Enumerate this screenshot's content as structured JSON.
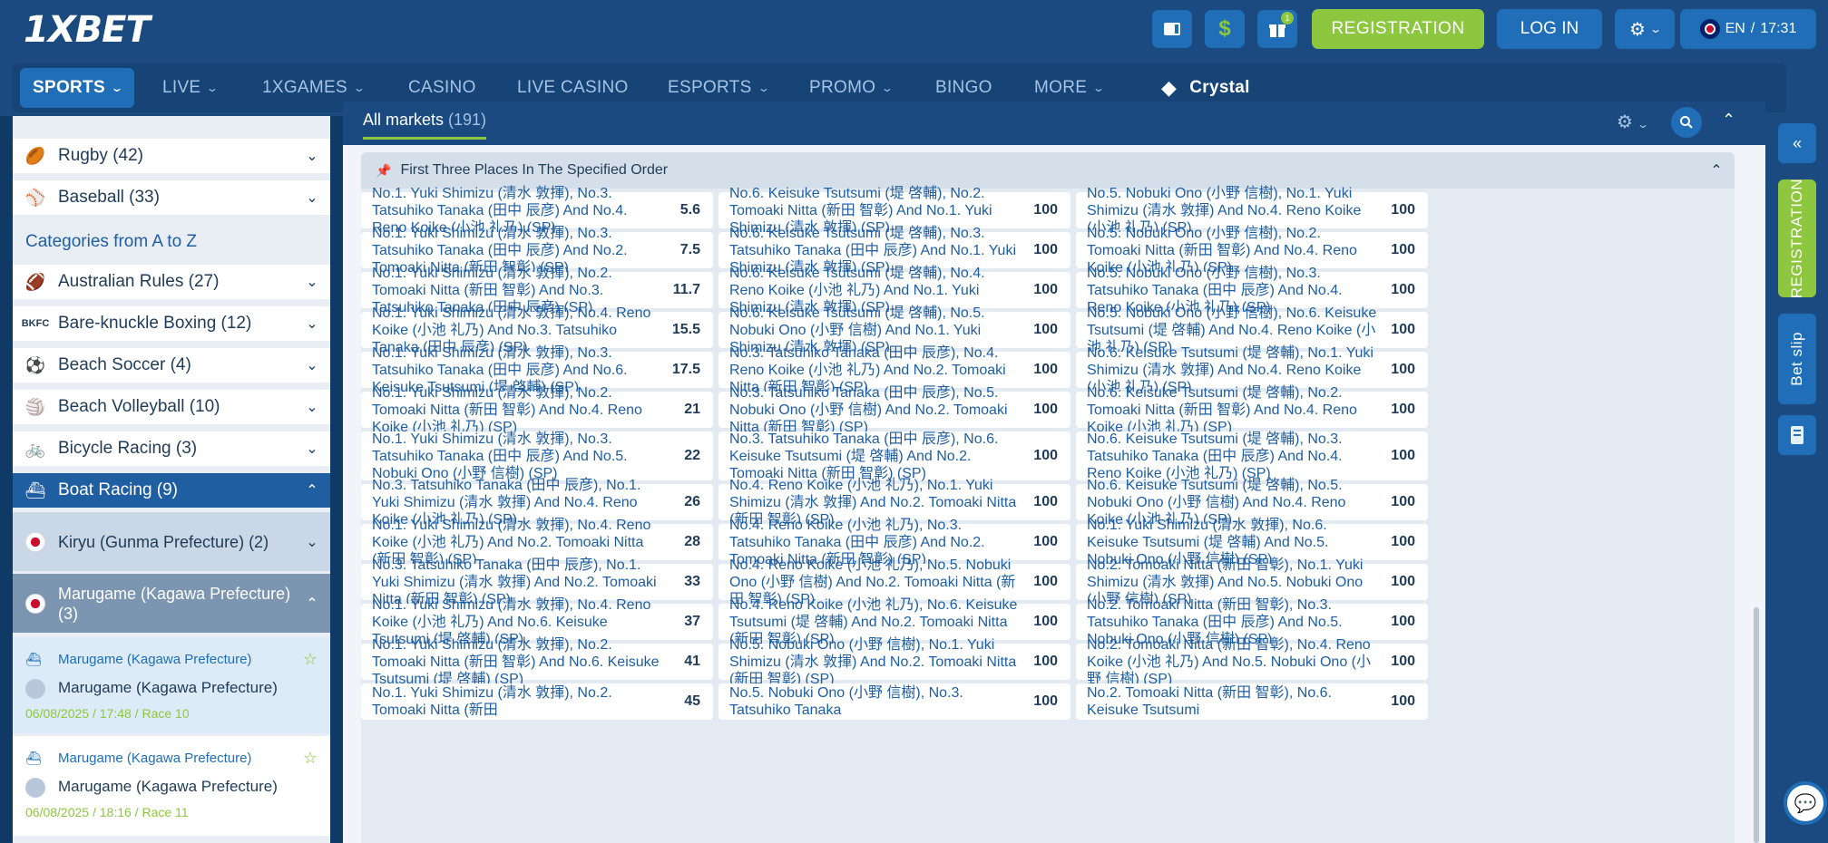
{
  "brand": {
    "logo": "1XBET"
  },
  "topbar": {
    "gift_badge": "1",
    "registration": "REGISTRATION",
    "login": "LOG IN",
    "lang": "EN",
    "separator": "/",
    "time": "17:31"
  },
  "nav": {
    "items": [
      {
        "label": "SPORTS",
        "chevron": true
      },
      {
        "label": "LIVE",
        "chevron": true
      },
      {
        "label": "1XGAMES",
        "chevron": true
      },
      {
        "label": "CASINO",
        "chevron": false
      },
      {
        "label": "LIVE CASINO",
        "chevron": false
      },
      {
        "label": "ESPORTS",
        "chevron": true
      },
      {
        "label": "PROMO",
        "chevron": true
      },
      {
        "label": "BINGO",
        "chevron": false
      },
      {
        "label": "MORE",
        "chevron": true
      },
      {
        "label": "Crystal",
        "chevron": false
      }
    ]
  },
  "sidebar": {
    "top_sports": [
      {
        "label": "Rugby (42)",
        "icon": "rugby-ball-icon"
      },
      {
        "label": "Baseball (33)",
        "icon": "baseball-icon"
      }
    ],
    "categories_heading": "Categories from A to Z",
    "categories": [
      {
        "label": "Australian Rules (27)",
        "icon": "aussie-rules-ball-icon"
      },
      {
        "label": "Bare-knuckle Boxing (12)",
        "icon": "boxing-icon"
      },
      {
        "label": "Beach Soccer (4)",
        "icon": "soccer-ball-icon"
      },
      {
        "label": "Beach Volleyball (10)",
        "icon": "volleyball-icon"
      },
      {
        "label": "Bicycle Racing (3)",
        "icon": "bicycle-icon"
      }
    ],
    "boat": {
      "label": "Boat Racing (9)",
      "icon": "boat-icon"
    },
    "leagues": [
      {
        "label": "Kiryu (Gunma Prefecture) (2)"
      },
      {
        "label": "Marugame (Kagawa Prefecture) (3)"
      }
    ],
    "events": [
      {
        "league": "Marugame (Kagawa Prefecture)",
        "name": "Marugame (Kagawa Prefecture)",
        "date": "06/08/2025",
        "sep": " / ",
        "time": "17:48",
        "race": "Race 10"
      },
      {
        "league": "Marugame (Kagawa Prefecture)",
        "name": "Marugame (Kagawa Prefecture)",
        "date": "06/08/2025",
        "sep": " / ",
        "time": "18:16",
        "race": "Race 11"
      }
    ]
  },
  "markets": {
    "tab_label": "All markets",
    "tab_count": "(191)",
    "group_title": "First Three Places In The Specified Order",
    "rows": [
      [
        {
          "t": "No.1. Yuki Shimizu (清水 敦揮), No.3. Tatsuhiko Tanaka (田中 辰彦) And No.4. Reno Koike (小池 礼乃) (SP)",
          "o": "5.6"
        },
        {
          "t": "No.6. Keisuke Tsutsumi (堤 啓輔), No.2. Tomoaki Nitta (新田 智彰) And No.1. Yuki Shimizu (清水 敦揮) (SP)",
          "o": "100"
        },
        {
          "t": "No.5. Nobuki Ono (小野 信樹), No.1. Yuki Shimizu (清水 敦揮) And No.4. Reno Koike (小池 礼乃) (SP)",
          "o": "100"
        }
      ],
      [
        {
          "t": "No.1. Yuki Shimizu (清水 敦揮), No.3. Tatsuhiko Tanaka (田中 辰彦) And No.2. Tomoaki Nitta (新田 智彰) (SP)",
          "o": "7.5"
        },
        {
          "t": "No.6. Keisuke Tsutsumi (堤 啓輔), No.3. Tatsuhiko Tanaka (田中 辰彦) And No.1. Yuki Shimizu (清水 敦揮) (SP)",
          "o": "100"
        },
        {
          "t": "No.5. Nobuki Ono (小野 信樹), No.2. Tomoaki Nitta (新田 智彰) And No.4. Reno Koike (小池 礼乃) (SP)",
          "o": "100"
        }
      ],
      [
        {
          "t": "No.1. Yuki Shimizu (清水 敦揮), No.2. Tomoaki Nitta (新田 智彰) And No.3. Tatsuhiko Tanaka (田中 辰彦) (SP)",
          "o": "11.7"
        },
        {
          "t": "No.6. Keisuke Tsutsumi (堤 啓輔), No.4. Reno Koike (小池 礼乃) And No.1. Yuki Shimizu (清水 敦揮) (SP)",
          "o": "100"
        },
        {
          "t": "No.5. Nobuki Ono (小野 信樹), No.3. Tatsuhiko Tanaka (田中 辰彦) And No.4. Reno Koike (小池 礼乃) (SP)",
          "o": "100"
        }
      ],
      [
        {
          "t": "No.1. Yuki Shimizu (清水 敦揮), No.4. Reno Koike (小池 礼乃) And No.3. Tatsuhiko Tanaka (田中 辰彦) (SP)",
          "o": "15.5"
        },
        {
          "t": "No.6. Keisuke Tsutsumi (堤 啓輔), No.5. Nobuki Ono (小野 信樹) And No.1. Yuki Shimizu (清水 敦揮) (SP)",
          "o": "100"
        },
        {
          "t": "No.5. Nobuki Ono (小野 信樹), No.6. Keisuke Tsutsumi (堤 啓輔) And No.4. Reno Koike (小池 礼乃) (SP)",
          "o": "100"
        }
      ],
      [
        {
          "t": "No.1. Yuki Shimizu (清水 敦揮), No.3. Tatsuhiko Tanaka (田中 辰彦) And No.6. Keisuke Tsutsumi (堤 啓輔) (SP)",
          "o": "17.5"
        },
        {
          "t": "No.3. Tatsuhiko Tanaka (田中 辰彦), No.4. Reno Koike (小池 礼乃) And No.2. Tomoaki Nitta (新田 智彰) (SP)",
          "o": "100"
        },
        {
          "t": "No.6. Keisuke Tsutsumi (堤 啓輔), No.1. Yuki Shimizu (清水 敦揮) And No.4. Reno Koike (小池 礼乃) (SP)",
          "o": "100"
        }
      ],
      [
        {
          "t": "No.1. Yuki Shimizu (清水 敦揮), No.2. Tomoaki Nitta (新田 智彰) And No.4. Reno Koike (小池 礼乃) (SP)",
          "o": "21"
        },
        {
          "t": "No.3. Tatsuhiko Tanaka (田中 辰彦), No.5. Nobuki Ono (小野 信樹) And No.2. Tomoaki Nitta (新田 智彰) (SP)",
          "o": "100"
        },
        {
          "t": "No.6. Keisuke Tsutsumi (堤 啓輔), No.2. Tomoaki Nitta (新田 智彰) And No.4. Reno Koike (小池 礼乃) (SP)",
          "o": "100"
        }
      ],
      [
        {
          "t": "No.1. Yuki Shimizu (清水 敦揮), No.3. Tatsuhiko Tanaka (田中 辰彦) And No.5. Nobuki Ono (小野 信樹) (SP)",
          "o": "22"
        },
        {
          "t": "No.3. Tatsuhiko Tanaka (田中 辰彦), No.6. Keisuke Tsutsumi (堤 啓輔) And No.2. Tomoaki Nitta (新田 智彰) (SP)",
          "o": "100"
        },
        {
          "t": "No.6. Keisuke Tsutsumi (堤 啓輔), No.3. Tatsuhiko Tanaka (田中 辰彦) And No.4. Reno Koike (小池 礼乃) (SP)",
          "o": "100"
        }
      ],
      [
        {
          "t": "No.3. Tatsuhiko Tanaka (田中 辰彦), No.1. Yuki Shimizu (清水 敦揮) And No.4. Reno Koike (小池 礼乃) (SP)",
          "o": "26"
        },
        {
          "t": "No.4. Reno Koike (小池 礼乃), No.1. Yuki Shimizu (清水 敦揮) And No.2. Tomoaki Nitta (新田 智彰) (SP)",
          "o": "100"
        },
        {
          "t": "No.6. Keisuke Tsutsumi (堤 啓輔), No.5. Nobuki Ono (小野 信樹) And No.4. Reno Koike (小池 礼乃) (SP)",
          "o": "100"
        }
      ],
      [
        {
          "t": "No.1. Yuki Shimizu (清水 敦揮), No.4. Reno Koike (小池 礼乃) And No.2. Tomoaki Nitta (新田 智彰) (SP)",
          "o": "28"
        },
        {
          "t": "No.4. Reno Koike (小池 礼乃), No.3. Tatsuhiko Tanaka (田中 辰彦) And No.2. Tomoaki Nitta (新田 智彰) (SP)",
          "o": "100"
        },
        {
          "t": "No.1. Yuki Shimizu (清水 敦揮), No.6. Keisuke Tsutsumi (堤 啓輔) And No.5. Nobuki Ono (小野 信樹) (SP)",
          "o": "100"
        }
      ],
      [
        {
          "t": "No.3. Tatsuhiko Tanaka (田中 辰彦), No.1. Yuki Shimizu (清水 敦揮) And No.2. Tomoaki Nitta (新田 智彰) (SP)",
          "o": "33"
        },
        {
          "t": "No.4. Reno Koike (小池 礼乃), No.5. Nobuki Ono (小野 信樹) And No.2. Tomoaki Nitta (新田 智彰) (SP)",
          "o": "100"
        },
        {
          "t": "No.2. Tomoaki Nitta (新田 智彰), No.1. Yuki Shimizu (清水 敦揮) And No.5. Nobuki Ono (小野 信樹) (SP)",
          "o": "100"
        }
      ],
      [
        {
          "t": "No.1. Yuki Shimizu (清水 敦揮), No.4. Reno Koike (小池 礼乃) And No.6. Keisuke Tsutsumi (堤 啓輔) (SP)",
          "o": "37"
        },
        {
          "t": "No.4. Reno Koike (小池 礼乃), No.6. Keisuke Tsutsumi (堤 啓輔) And No.2. Tomoaki Nitta (新田 智彰) (SP)",
          "o": "100"
        },
        {
          "t": "No.2. Tomoaki Nitta (新田 智彰), No.3. Tatsuhiko Tanaka (田中 辰彦) And No.5. Nobuki Ono (小野 信樹) (SP)",
          "o": "100"
        }
      ],
      [
        {
          "t": "No.1. Yuki Shimizu (清水 敦揮), No.2. Tomoaki Nitta (新田 智彰) And No.6. Keisuke Tsutsumi (堤 啓輔) (SP)",
          "o": "41"
        },
        {
          "t": "No.5. Nobuki Ono (小野 信樹), No.1. Yuki Shimizu (清水 敦揮) And No.2. Tomoaki Nitta (新田 智彰) (SP)",
          "o": "100"
        },
        {
          "t": "No.2. Tomoaki Nitta (新田 智彰), No.4. Reno Koike (小池 礼乃) And No.5. Nobuki Ono (小野 信樹) (SP)",
          "o": "100"
        }
      ],
      [
        {
          "t": "No.1. Yuki Shimizu (清水 敦揮), No.2. Tomoaki Nitta (新田",
          "o": "45"
        },
        {
          "t": "No.5. Nobuki Ono (小野 信樹), No.3. Tatsuhiko Tanaka",
          "o": "100"
        },
        {
          "t": "No.2. Tomoaki Nitta (新田 智彰), No.6. Keisuke Tsutsumi",
          "o": "100"
        }
      ]
    ]
  },
  "rail": {
    "registration": "REGISTRATION",
    "bet_slip": "Bet slip"
  },
  "colors": {
    "header_bg": "#1a4a80",
    "accent_blue": "#1f6eb7",
    "accent_green": "#8dc63f",
    "link_blue": "#1f5ea0"
  }
}
